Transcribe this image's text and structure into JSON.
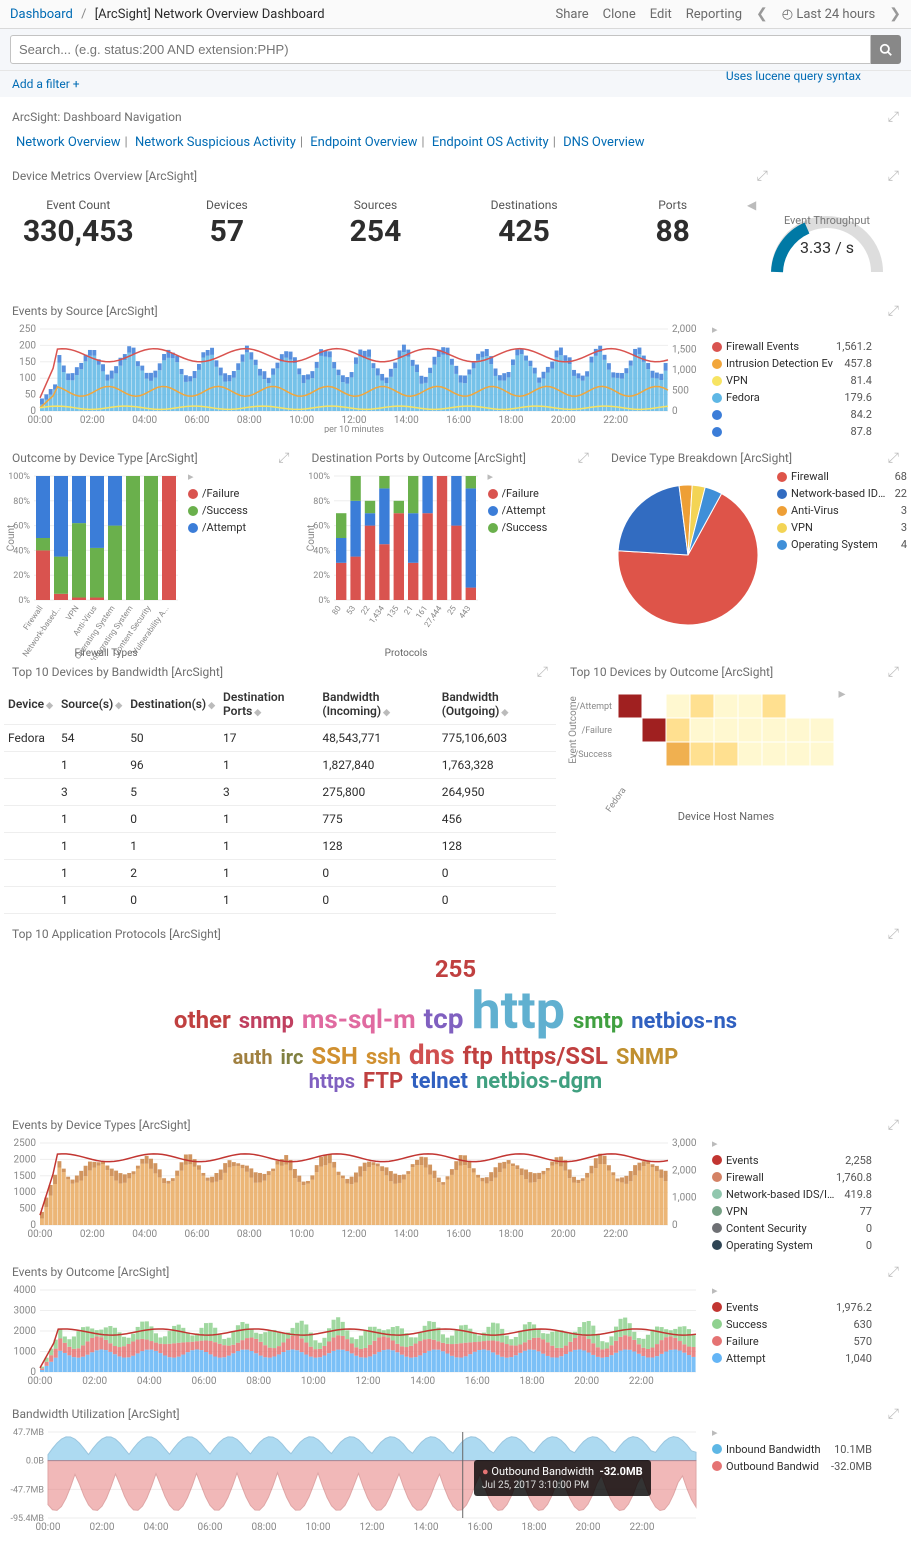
{
  "breadcrumb": {
    "root": "Dashboard",
    "title": "[ArcSight] Network Overview Dashboard"
  },
  "topbar": {
    "share": "Share",
    "clone": "Clone",
    "edit": "Edit",
    "reporting": "Reporting",
    "timerange": "Last 24 hours"
  },
  "search": {
    "placeholder": "Search... (e.g. status:200 AND extension:PHP)",
    "hint": "Uses lucene query syntax"
  },
  "filter": {
    "add": "Add a filter +"
  },
  "panels": {
    "nav": {
      "title": "ArcSight: Dashboard Navigation",
      "links": [
        "Network Overview",
        "Network Suspicious Activity",
        "Endpoint Overview",
        "Endpoint OS Activity",
        "DNS Overview"
      ]
    },
    "metrics": {
      "title": "Device Metrics Overview [ArcSight]",
      "items": [
        {
          "label": "Event Count",
          "value": "330,453"
        },
        {
          "label": "Devices",
          "value": "57"
        },
        {
          "label": "Sources",
          "value": "254"
        },
        {
          "label": "Destinations",
          "value": "425"
        },
        {
          "label": "Ports",
          "value": "88"
        }
      ],
      "gauge": {
        "label": "Event Throughput",
        "value": "3.33 / s"
      }
    },
    "ev_src": {
      "title": "Events by Source [ArcSight]",
      "xlabel": "per 10 minutes",
      "legend": [
        {
          "name": "Firewall Events",
          "value": "1,561.2",
          "color": "#d9534f"
        },
        {
          "name": "Intrusion Detection Ev",
          "value": "457.8",
          "color": "#f2a63b"
        },
        {
          "name": "VPN",
          "value": "81.4",
          "color": "#f7e463"
        },
        {
          "name": "Fedora",
          "value": "179.6",
          "color": "#5eb7e5"
        },
        {
          "name": "",
          "value": "84.2",
          "color": "#3b7dd8"
        },
        {
          "name": "",
          "value": "87.8",
          "color": "#3b7dd8"
        }
      ]
    },
    "outcome": {
      "title": "Outcome by Device Type [ArcSight]",
      "xlabel": "Firewall Types",
      "ylabel": "Count",
      "legend": [
        {
          "name": "/Failure",
          "color": "#d9534f"
        },
        {
          "name": "/Success",
          "color": "#6ab04c"
        },
        {
          "name": "/Attempt",
          "color": "#3b7dd8"
        }
      ],
      "cats": [
        "Firewall",
        "Network-based...",
        "VPN",
        "Anti-Virus",
        "Operating System",
        "Integrating System",
        "Content Security",
        "Vulnerability A..."
      ]
    },
    "destports": {
      "title": "Destination Ports by Outcome [ArcSight]",
      "xlabel": "Protocols",
      "ylabel": "Count",
      "legend": [
        {
          "name": "/Failure",
          "color": "#d9534f"
        },
        {
          "name": "/Attempt",
          "color": "#3b7dd8"
        },
        {
          "name": "/Success",
          "color": "#6ab04c"
        }
      ],
      "cats": [
        "80",
        "53",
        "22",
        "1,434",
        "135",
        "21",
        "161",
        "27,444",
        "25",
        "443"
      ]
    },
    "breakdown": {
      "title": "Device Type Breakdown [ArcSight]",
      "legend": [
        {
          "name": "Firewall",
          "color": "#de5449",
          "value": 68
        },
        {
          "name": "Network-based IDS/IPS",
          "color": "#326cc1",
          "value": 22
        },
        {
          "name": "Anti-Virus",
          "color": "#ee9f36",
          "value": 3
        },
        {
          "name": "VPN",
          "color": "#f3d455",
          "value": 3
        },
        {
          "name": "Operating System",
          "color": "#3f8fd8",
          "value": 4
        }
      ]
    },
    "bw": {
      "title": "Top 10 Devices by Bandwidth [ArcSight]",
      "headers": [
        "Device",
        "Source(s)",
        "Destination(s)",
        "Destination Ports",
        "Bandwidth (Incoming)",
        "Bandwidth (Outgoing)"
      ],
      "rows": [
        [
          "Fedora",
          "54",
          "50",
          "17",
          "48,543,771",
          "775,106,603"
        ],
        [
          "",
          "1",
          "96",
          "1",
          "1,827,840",
          "1,763,328"
        ],
        [
          "",
          "3",
          "5",
          "3",
          "275,800",
          "264,950"
        ],
        [
          "",
          "1",
          "0",
          "1",
          "775",
          "456"
        ],
        [
          "",
          "1",
          "1",
          "1",
          "128",
          "128"
        ],
        [
          "",
          "1",
          "2",
          "1",
          "0",
          "0"
        ],
        [
          "",
          "1",
          "0",
          "1",
          "0",
          "0"
        ]
      ]
    },
    "top10out": {
      "title": "Top 10 Devices by Outcome [ArcSight]",
      "ylabel": "Event Outcome",
      "xlabel": "Device Host Names",
      "ycats": [
        "/Attempt",
        "/Failure",
        "/Success"
      ],
      "xcats": [
        "Fedora"
      ]
    },
    "app": {
      "title": "Top 10 Application Protocols [ArcSight]",
      "words": [
        {
          "t": "255",
          "s": 24,
          "c": "#c04040"
        },
        {
          "t": "other",
          "s": 24,
          "c": "#c04040"
        },
        {
          "t": "snmp",
          "s": 22,
          "c": "#c04060"
        },
        {
          "t": "ms-sql-m",
          "s": 26,
          "c": "#e06aa0"
        },
        {
          "t": "tcp",
          "s": 28,
          "c": "#8060c0"
        },
        {
          "t": "http",
          "s": 52,
          "c": "#60b0d0"
        },
        {
          "t": "smtp",
          "s": 22,
          "c": "#40a040"
        },
        {
          "t": "netbios-ns",
          "s": 22,
          "c": "#3060c0"
        },
        {
          "t": "auth",
          "s": 20,
          "c": "#a08040"
        },
        {
          "t": "irc",
          "s": 20,
          "c": "#808040"
        },
        {
          "t": "SSH",
          "s": 24,
          "c": "#d09030"
        },
        {
          "t": "ssh",
          "s": 22,
          "c": "#d09030"
        },
        {
          "t": "dns",
          "s": 28,
          "c": "#d05050"
        },
        {
          "t": "ftp",
          "s": 24,
          "c": "#c04040"
        },
        {
          "t": "https/SSL",
          "s": 24,
          "c": "#c04040"
        },
        {
          "t": "SNMP",
          "s": 22,
          "c": "#c09030"
        },
        {
          "t": "https",
          "s": 20,
          "c": "#8060c0"
        },
        {
          "t": "FTP",
          "s": 22,
          "c": "#c04040"
        },
        {
          "t": "telnet",
          "s": 22,
          "c": "#3060c0"
        },
        {
          "t": "netbios-dgm",
          "s": 22,
          "c": "#40a080"
        }
      ]
    },
    "ev_dev": {
      "title": "Events by Device Types [ArcSight]",
      "legend": [
        {
          "name": "Events",
          "value": "2,258",
          "color": "#c23531"
        },
        {
          "name": "Firewall",
          "value": "1,760.8",
          "color": "#d48265"
        },
        {
          "name": "Network-based IDS/IPS",
          "value": "419.8",
          "color": "#91c7ae"
        },
        {
          "name": "VPN",
          "value": "77",
          "color": "#749f83"
        },
        {
          "name": "Content Security",
          "value": "0",
          "color": "#6e7074"
        },
        {
          "name": "Operating System",
          "value": "0",
          "color": "#2f4554"
        }
      ]
    },
    "ev_out": {
      "title": "Events by Outcome [ArcSight]",
      "legend": [
        {
          "name": "Events",
          "value": "1,976.2",
          "color": "#c23531"
        },
        {
          "name": "Success",
          "value": "630",
          "color": "#8fd18f"
        },
        {
          "name": "Failure",
          "value": "570",
          "color": "#e57373"
        },
        {
          "name": "Attempt",
          "value": "1,040",
          "color": "#64b5f6"
        }
      ]
    },
    "bwu": {
      "title": "Bandwidth Utilization [ArcSight]",
      "legend": [
        {
          "name": "Inbound Bandwidth",
          "value": "10.1MB",
          "color": "#5eb7e5"
        },
        {
          "name": "Outbound Bandwid",
          "value": "-32.0MB",
          "color": "#e57373"
        }
      ],
      "tooltip": {
        "series": "Outbound Bandwidth",
        "value": "-32.0MB",
        "time": "Jul 25, 2017 3:10:00 PM"
      }
    }
  },
  "chart_data": [
    {
      "type": "bar+line",
      "id": "ev_src",
      "x_hours": [
        0,
        2,
        4,
        6,
        8,
        10,
        12,
        14,
        16,
        18,
        20,
        22
      ],
      "ylim_left": [
        0,
        250
      ],
      "ylim_right": [
        0,
        2000
      ],
      "yticks_left": [
        0,
        50,
        100,
        150,
        200,
        250
      ],
      "yticks_right": [
        0,
        500,
        1000,
        1500,
        2000
      ],
      "series_line": [
        {
          "name": "Firewall Events",
          "values_approx": 180
        },
        {
          "name": "Intrusion Detection Ev",
          "values_approx": 70
        },
        {
          "name": "VPN",
          "values_approx": 20
        }
      ],
      "series_bars": [
        {
          "name": "Fedora",
          "approx": 30
        },
        {
          "name": "",
          "approx": 15
        }
      ]
    },
    {
      "type": "stacked-bar",
      "id": "outcome",
      "ylim": [
        0,
        100
      ],
      "yticks": [
        0,
        20,
        40,
        60,
        80,
        100
      ],
      "categories": [
        "Firewall",
        "Network-based...",
        "VPN",
        "Anti-Virus",
        "Operating System",
        "Integrating System",
        "Content Security",
        "Vulnerability A..."
      ],
      "stacks": [
        {
          "name": "/Failure"
        },
        {
          "name": "/Success"
        },
        {
          "name": "/Attempt"
        }
      ],
      "data_approx": [
        [
          40,
          10,
          50
        ],
        [
          5,
          30,
          65
        ],
        [
          2,
          60,
          38
        ],
        [
          2,
          40,
          58
        ],
        [
          0,
          60,
          40
        ],
        [
          0,
          100,
          0
        ],
        [
          0,
          100,
          0
        ],
        [
          100,
          0,
          0
        ]
      ]
    },
    {
      "type": "stacked-bar",
      "id": "destports",
      "ylim": [
        0,
        100
      ],
      "yticks": [
        0,
        20,
        40,
        60,
        80,
        100
      ],
      "categories": [
        "80",
        "53",
        "22",
        "1,434",
        "135",
        "21",
        "161",
        "27,444",
        "25",
        "443"
      ],
      "stacks": [
        {
          "name": "/Failure"
        },
        {
          "name": "/Attempt"
        },
        {
          "name": "/Success"
        }
      ],
      "data_approx": [
        [
          30,
          20,
          20
        ],
        [
          35,
          45,
          20
        ],
        [
          60,
          10,
          10
        ],
        [
          45,
          45,
          10
        ],
        [
          70,
          0,
          10
        ],
        [
          30,
          40,
          30
        ],
        [
          70,
          30,
          0
        ],
        [
          100,
          0,
          0
        ],
        [
          60,
          40,
          0
        ],
        [
          10,
          80,
          10
        ]
      ]
    },
    {
      "type": "pie",
      "id": "breakdown",
      "slices": [
        {
          "name": "Firewall",
          "value": 68,
          "color": "#de5449"
        },
        {
          "name": "Network-based IDS/IPS",
          "value": 22,
          "color": "#326cc1"
        },
        {
          "name": "Anti-Virus",
          "value": 3,
          "color": "#ee9f36"
        },
        {
          "name": "VPN",
          "value": 3,
          "color": "#f3d455"
        },
        {
          "name": "Operating System",
          "value": 4,
          "color": "#3f8fd8"
        }
      ]
    },
    {
      "type": "heatmap",
      "id": "top10out",
      "ycats": [
        "/Attempt",
        "/Failure",
        "/Success"
      ],
      "xcols": 9,
      "cells": [
        [
          1.0,
          null,
          0.2,
          0.5,
          0.2,
          0.2,
          0.4,
          null,
          null
        ],
        [
          null,
          1.0,
          0.5,
          0.2,
          0.2,
          0.2,
          0.2,
          0.2,
          0.2
        ],
        [
          null,
          null,
          0.6,
          0.4,
          0.4,
          0.2,
          0.2,
          0.2,
          0.2
        ]
      ]
    },
    {
      "type": "bar+line",
      "id": "ev_dev",
      "x_hours": [
        0,
        2,
        4,
        6,
        8,
        10,
        12,
        14,
        16,
        18,
        20,
        22
      ],
      "ylim_left": [
        0,
        2500
      ],
      "ylim_right": [
        0,
        3000
      ],
      "yticks_left": [
        0,
        500,
        1000,
        1500,
        2000,
        2500
      ],
      "yticks_right": [
        0,
        1000,
        2000,
        3000
      ]
    },
    {
      "type": "bar+line",
      "id": "ev_out",
      "x_hours": [
        0,
        2,
        4,
        6,
        8,
        10,
        12,
        14,
        16,
        18,
        20,
        22
      ],
      "ylim_left": [
        0,
        4000
      ],
      "yticks_left": [
        0,
        1000,
        2000,
        3000,
        4000
      ]
    },
    {
      "type": "area",
      "id": "bwu",
      "x_hours": [
        0,
        2,
        4,
        6,
        8,
        10,
        12,
        14,
        16,
        18,
        20,
        22
      ],
      "yticks": [
        "47.7MB",
        "0.0B",
        "-47.7MB",
        "-95.4MB"
      ]
    }
  ]
}
